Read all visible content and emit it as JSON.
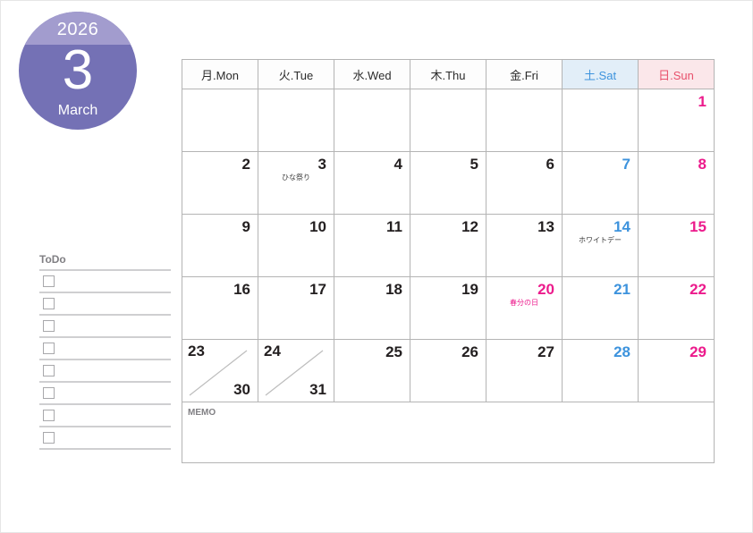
{
  "badge": {
    "year": "2026",
    "month_number": "3",
    "month_name": "March",
    "color_top": "#a29cce",
    "color_bottom": "#7471b5"
  },
  "todo": {
    "title": "ToDo",
    "row_count": 8
  },
  "memo": {
    "label": "MEMO"
  },
  "colors": {
    "saturday": "#3d93dd",
    "sunday": "#ec1b8c",
    "holiday": "#ec1b8c",
    "saturday_header_bg": "#e2eef8",
    "sunday_header_bg": "#fbe7ea",
    "grid": "#b4b4b4"
  },
  "calendar": {
    "headers": [
      {
        "label": "月.Mon",
        "kind": "weekday"
      },
      {
        "label": "火.Tue",
        "kind": "weekday"
      },
      {
        "label": "水.Wed",
        "kind": "weekday"
      },
      {
        "label": "木.Thu",
        "kind": "weekday"
      },
      {
        "label": "金.Fri",
        "kind": "weekday"
      },
      {
        "label": "土.Sat",
        "kind": "sat"
      },
      {
        "label": "日.Sun",
        "kind": "sun"
      }
    ],
    "weeks": [
      [
        {
          "num": "",
          "kind": "empty"
        },
        {
          "num": "",
          "kind": "empty"
        },
        {
          "num": "",
          "kind": "empty"
        },
        {
          "num": "",
          "kind": "empty"
        },
        {
          "num": "",
          "kind": "empty"
        },
        {
          "num": "",
          "kind": "empty"
        },
        {
          "num": "1",
          "kind": "sun",
          "event": ""
        }
      ],
      [
        {
          "num": "2",
          "kind": "weekday",
          "event": ""
        },
        {
          "num": "3",
          "kind": "weekday",
          "event": "ひな祭り"
        },
        {
          "num": "4",
          "kind": "weekday",
          "event": ""
        },
        {
          "num": "5",
          "kind": "weekday",
          "event": ""
        },
        {
          "num": "6",
          "kind": "weekday",
          "event": ""
        },
        {
          "num": "7",
          "kind": "sat",
          "event": ""
        },
        {
          "num": "8",
          "kind": "sun",
          "event": ""
        }
      ],
      [
        {
          "num": "9",
          "kind": "weekday",
          "event": ""
        },
        {
          "num": "10",
          "kind": "weekday",
          "event": ""
        },
        {
          "num": "11",
          "kind": "weekday",
          "event": ""
        },
        {
          "num": "12",
          "kind": "weekday",
          "event": ""
        },
        {
          "num": "13",
          "kind": "weekday",
          "event": ""
        },
        {
          "num": "14",
          "kind": "sat",
          "event": "ホワイトデー"
        },
        {
          "num": "15",
          "kind": "sun",
          "event": ""
        }
      ],
      [
        {
          "num": "16",
          "kind": "weekday",
          "event": ""
        },
        {
          "num": "17",
          "kind": "weekday",
          "event": ""
        },
        {
          "num": "18",
          "kind": "weekday",
          "event": ""
        },
        {
          "num": "19",
          "kind": "weekday",
          "event": ""
        },
        {
          "num": "20",
          "kind": "holiday",
          "event": "春分の日"
        },
        {
          "num": "21",
          "kind": "sat",
          "event": ""
        },
        {
          "num": "22",
          "kind": "sun",
          "event": ""
        }
      ],
      [
        {
          "num": "23",
          "num2": "30",
          "kind": "split"
        },
        {
          "num": "24",
          "num2": "31",
          "kind": "split"
        },
        {
          "num": "25",
          "kind": "weekday",
          "event": ""
        },
        {
          "num": "26",
          "kind": "weekday",
          "event": ""
        },
        {
          "num": "27",
          "kind": "weekday",
          "event": ""
        },
        {
          "num": "28",
          "kind": "sat",
          "event": ""
        },
        {
          "num": "29",
          "kind": "sun",
          "event": ""
        }
      ]
    ]
  }
}
